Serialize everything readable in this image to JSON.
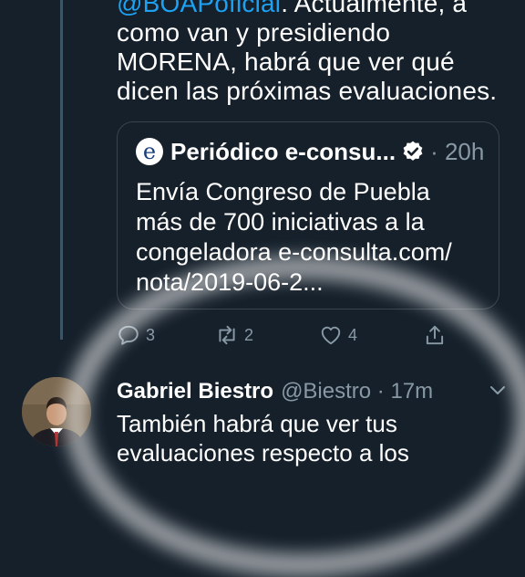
{
  "tweet": {
    "mention": "@BOAPoficial",
    "text": ". Actualmente, a como van y presidiendo MORENA, habrá que ver qué dicen las próximas evaluaciones."
  },
  "quoted_tweet": {
    "name": "Periódico e-consu...",
    "time": "· 20h",
    "text": "Envía Congreso de Puebla más de 700 iniciativas a la congeladora e-consulta.com/ nota/2019-06-2..."
  },
  "actions": {
    "reply_count": "3",
    "retweet_count": "2",
    "like_count": "4"
  },
  "reply": {
    "name": "Gabriel Biestro",
    "handle": "@Biestro · 17m",
    "text": "También habrá que ver tus evaluaciones respecto a los"
  },
  "colors": {
    "background": "#15202b",
    "link": "#1da1f2",
    "muted": "#8899a6",
    "border": "#38444d"
  }
}
